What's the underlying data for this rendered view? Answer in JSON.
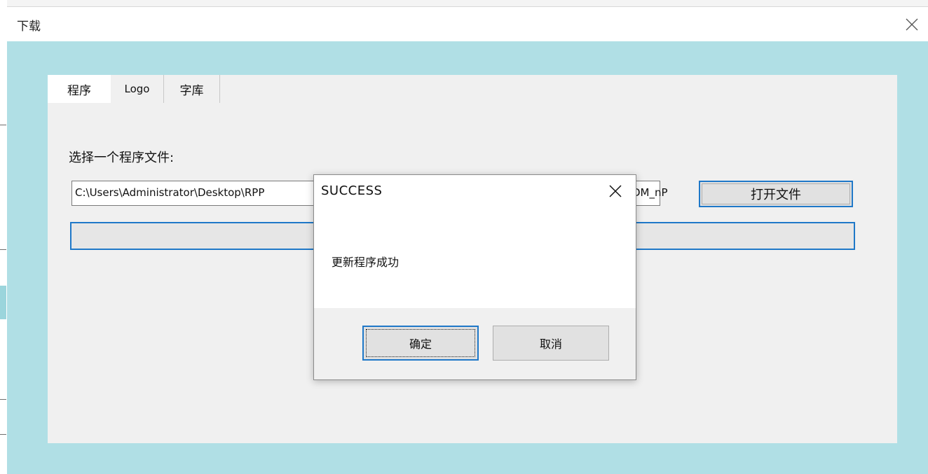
{
  "window": {
    "title": "下载",
    "tabs": [
      {
        "label": "程序",
        "active": true
      },
      {
        "label": "Logo",
        "active": false
      },
      {
        "label": "字库",
        "active": false
      }
    ],
    "select_label": "选择一个程序文件:",
    "file_path": "C:\\Users\\Administrator\\Desktop\\RPP",
    "file_path_tail": "DM_nP",
    "open_button": "打开文件",
    "progress": 0
  },
  "dialog": {
    "title": "SUCCESS",
    "message": "更新程序成功",
    "ok_label": "确定",
    "cancel_label": "取消"
  },
  "colors": {
    "client_bg": "#b0dfe5",
    "panel_bg": "#f0f0f0",
    "focus_blue": "#1f78c8"
  }
}
